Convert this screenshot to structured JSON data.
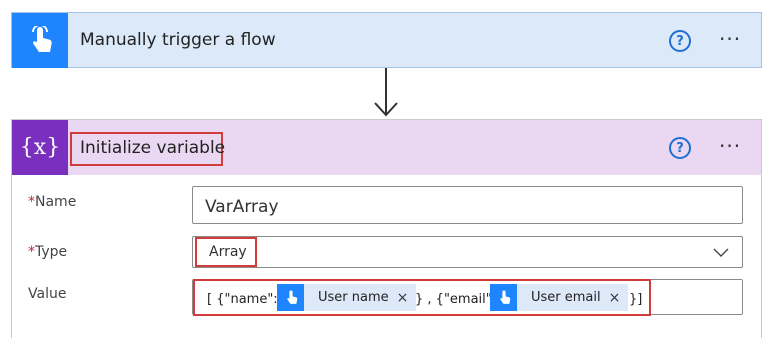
{
  "trigger": {
    "title": "Manually trigger a flow",
    "help_glyph": "?",
    "more_glyph": "···",
    "icon": "touch-icon"
  },
  "init_variable": {
    "title": "Initialize variable",
    "icon_glyph": "{x}",
    "help_glyph": "?",
    "more_glyph": "···",
    "fields": {
      "name": {
        "required_mark": "*",
        "label": "Name",
        "value": "VarArray"
      },
      "type": {
        "required_mark": "*",
        "label": "Type",
        "value": "Array"
      },
      "value": {
        "label": "Value",
        "expr_open": "[ {\"name\":",
        "expr_middle": "} , {\"email\":",
        "expr_close": "}]",
        "token_user_name": "User name",
        "token_user_email": "User email",
        "token_close_glyph": "×"
      }
    }
  },
  "colors": {
    "trigger_header": "#dbe9f9",
    "trigger_icon_bg": "#1f85ff",
    "variable_header": "#ead8f2",
    "variable_icon_bg": "#7b2fbe",
    "highlight_border": "#d23c3c",
    "token_bg": "#dde9f9"
  }
}
